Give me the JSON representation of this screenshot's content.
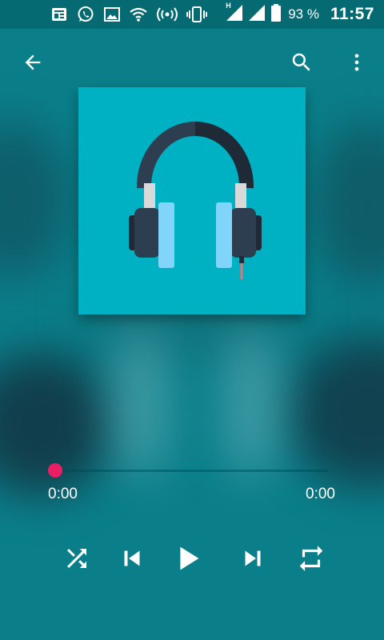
{
  "status_bar": {
    "battery_percent": "93 %",
    "time": "11:57",
    "network_type": "H",
    "icons": [
      "news-icon",
      "whatsapp-icon",
      "gallery-icon",
      "wifi-icon",
      "hotspot-icon",
      "vibrate-icon",
      "signal-icon",
      "signal-icon",
      "battery-icon"
    ]
  },
  "toolbar": {
    "back_icon": "arrow-back-icon",
    "search_icon": "search-icon",
    "more_icon": "more-vert-icon"
  },
  "album_art": {
    "icon": "headphones-icon",
    "background": "#00b1c4"
  },
  "player": {
    "elapsed": "0:00",
    "duration": "0:00",
    "progress": 0,
    "accent_color": "#e91e63"
  },
  "controls": [
    "shuffle-icon",
    "skip-previous-icon",
    "play-icon",
    "skip-next-icon",
    "repeat-icon"
  ]
}
